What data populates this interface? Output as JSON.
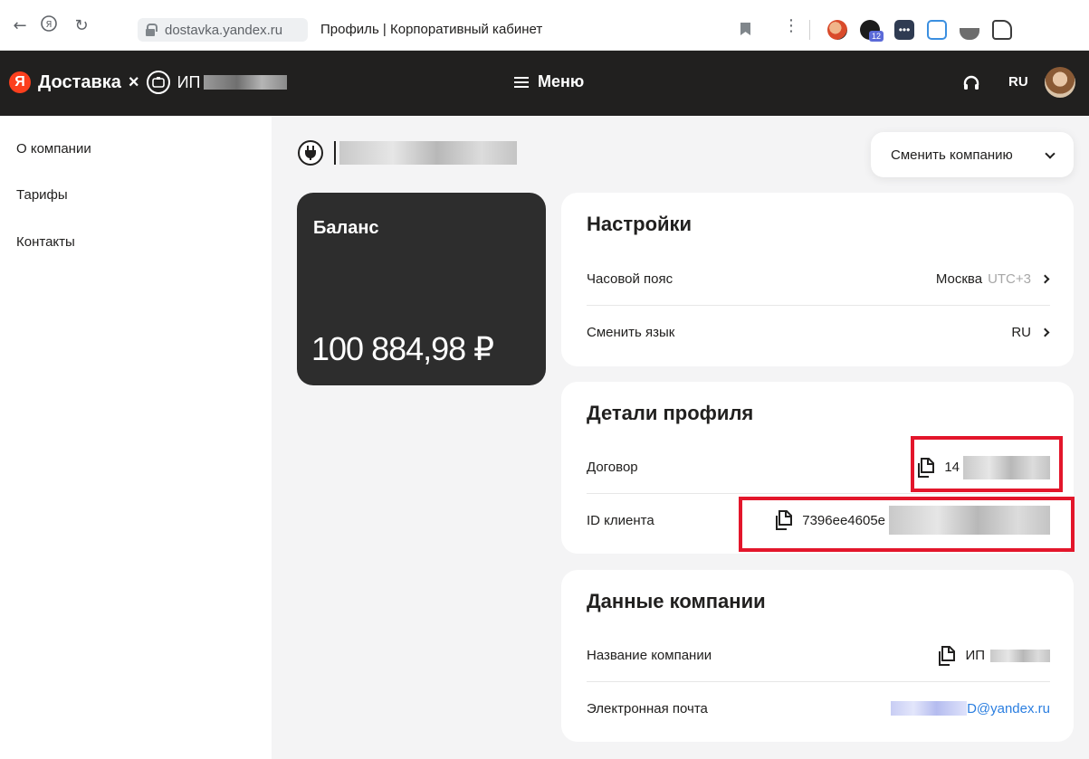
{
  "browser": {
    "url": "dostavka.yandex.ru",
    "page_title": "Профиль | Корпоративный кабинет",
    "extension_badge": "12"
  },
  "header": {
    "brand": "Доставка",
    "separator": "×",
    "company_prefix": "ИП",
    "menu_label": "Меню",
    "language": "RU"
  },
  "sidebar": {
    "items": [
      {
        "label": "О компании"
      },
      {
        "label": "Тарифы"
      },
      {
        "label": "Контакты"
      }
    ]
  },
  "main": {
    "switch_company_label": "Сменить компанию",
    "balance": {
      "title": "Баланс",
      "value": "100 884,98 ₽"
    },
    "settings": {
      "title": "Настройки",
      "timezone_label": "Часовой пояс",
      "timezone_city": "Москва",
      "timezone_offset": "UTC+3",
      "language_label": "Сменить язык",
      "language_value": "RU"
    },
    "profile": {
      "title": "Детали профиля",
      "contract_label": "Договор",
      "contract_value": "14",
      "client_id_label": "ID клиента",
      "client_id_value": "7396ee4605e"
    },
    "company": {
      "title": "Данные компании",
      "name_label": "Название компании",
      "name_value": "ИП",
      "email_label": "Электронная почта",
      "email_value": "D@yandex.ru"
    }
  },
  "colors": {
    "header_bg": "#21201f",
    "brand_red": "#fc3f1d",
    "highlight_red": "#e3162b",
    "link_blue": "#2a7ee0"
  }
}
